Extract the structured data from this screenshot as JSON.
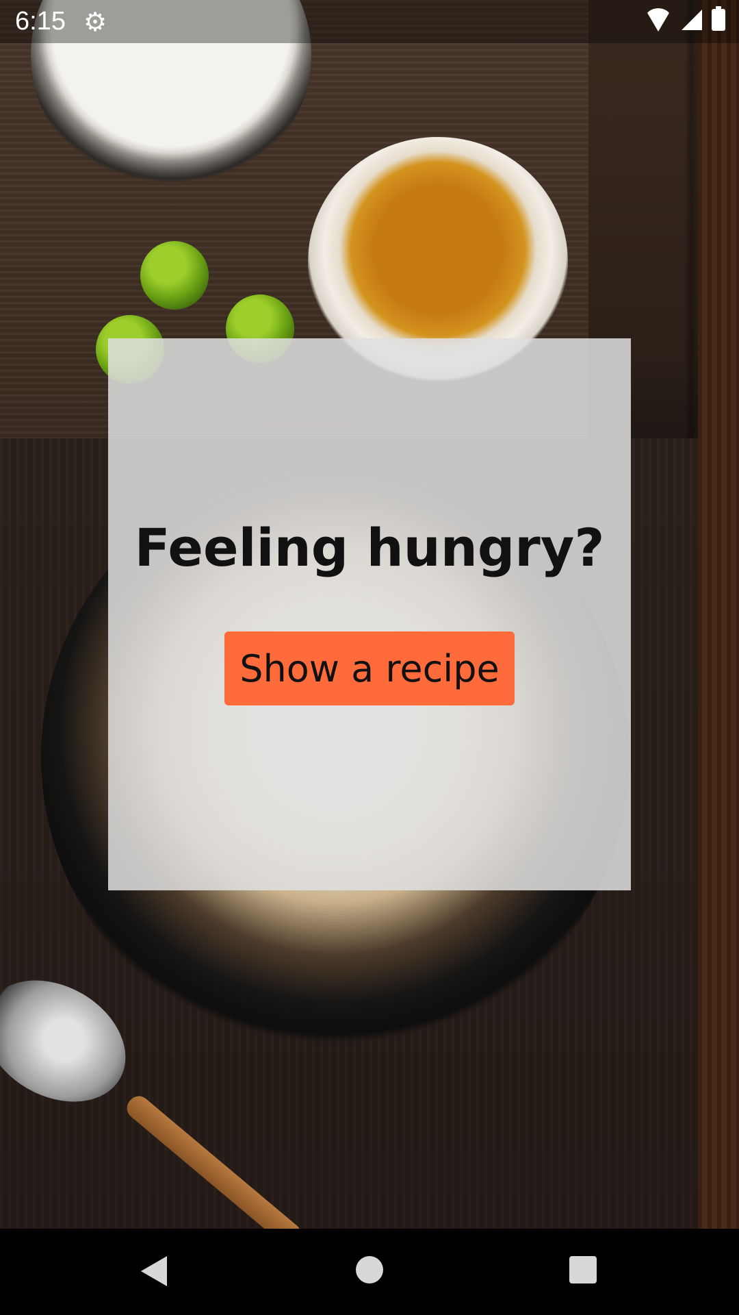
{
  "status_bar": {
    "time": "6:15",
    "icons": [
      "settings-gear-icon",
      "wifi-icon",
      "signal-icon",
      "battery-icon"
    ]
  },
  "card": {
    "title": "Feeling hungry?",
    "button_label": "Show a recipe"
  },
  "colors": {
    "accent": "#ff6b3b",
    "card_background": "#e0e0e0",
    "title_text": "#111111"
  },
  "nav_bar": {
    "icons": [
      "back-icon",
      "home-icon",
      "recents-icon"
    ]
  }
}
